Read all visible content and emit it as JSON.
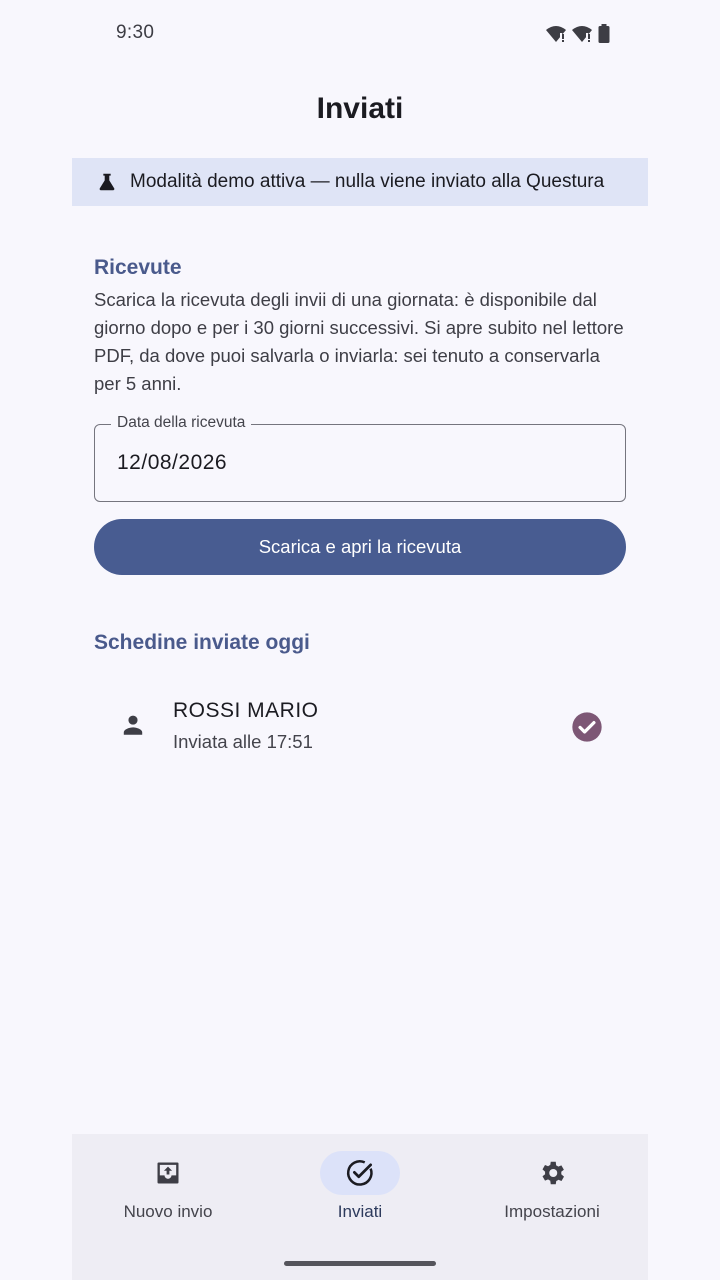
{
  "status_bar": {
    "time": "9:30",
    "icons": [
      "wifi-icon",
      "wifi-icon",
      "battery-icon"
    ]
  },
  "header": {
    "title": "Inviati"
  },
  "banner": {
    "icon": "flask-icon",
    "text": "Modalità demo attiva — nulla viene inviato alla Questura"
  },
  "receipts": {
    "title": "Ricevute",
    "description": "Scarica la ricevuta degli invii di una giornata: è disponibile dal giorno dopo e per i 30 giorni successivi. Si apre subito nel lettore PDF, da dove puoi salvarla o inviarla: sei tenuto a conservarla per 5 anni.",
    "date_label": "Data della ricevuta",
    "date_value": "12/08/2026",
    "button_label": "Scarica e apri la ricevuta"
  },
  "sent_today": {
    "title": "Schedine inviate oggi",
    "items": [
      {
        "icon": "person-icon",
        "name": "ROSSI MARIO",
        "subtitle": "Inviata alle 17:51",
        "status_icon": "check-circle-icon"
      }
    ]
  },
  "bottom_nav": {
    "items": [
      {
        "label": "Nuovo invio",
        "icon": "outbox-icon",
        "active": false
      },
      {
        "label": "Inviati",
        "icon": "check-circle-outline-icon",
        "active": true
      },
      {
        "label": "Impostazioni",
        "icon": "gear-icon",
        "active": false
      }
    ]
  },
  "colors": {
    "primary": "#485c91",
    "banner_bg": "#dfe4f6",
    "section_title": "#4a5a8c",
    "check": "#7d5775"
  }
}
